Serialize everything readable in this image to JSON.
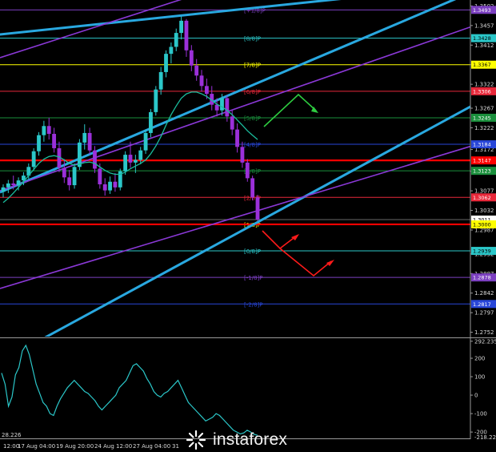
{
  "chart_data": [
    {
      "type": "candlestick",
      "instrument": "GBP/USD",
      "y_ticks": [
        "1.3502",
        "1.3457",
        "1.3412",
        "1.3367",
        "1.3322",
        "1.3267",
        "1.3222",
        "1.3172",
        "1.3122",
        "1.3077",
        "1.3032",
        "1.2987",
        "1.2932",
        "1.2887",
        "1.2842",
        "1.2797",
        "1.2752"
      ],
      "ylim": [
        1.2742,
        1.3512
      ],
      "price_tags": [
        {
          "value": "1.3493",
          "price": 1.3493,
          "color": "#7b3fc0"
        },
        {
          "value": "1.3428",
          "price": 1.3428,
          "color": "#2bc7c9"
        },
        {
          "value": "1.3367",
          "price": 1.3367,
          "color": "#ffff00"
        },
        {
          "value": "1.3306",
          "price": 1.3306,
          "color": "#e8283a"
        },
        {
          "value": "1.3245",
          "price": 1.3245,
          "color": "#1a8f3c"
        },
        {
          "value": "1.3184",
          "price": 1.3184,
          "color": "#2846d8"
        },
        {
          "value": "1.3147",
          "price": 1.3147,
          "color": "#ff0000"
        },
        {
          "value": "1.3123",
          "price": 1.3123,
          "color": "#1a8f3c"
        },
        {
          "value": "1.3062",
          "price": 1.3062,
          "color": "#e8283a"
        },
        {
          "value": "1.3011",
          "price": 1.3011,
          "color": "#ffffff"
        },
        {
          "value": "1.3000",
          "price": 1.3,
          "color": "#ffff00"
        },
        {
          "value": "1.2939",
          "price": 1.2939,
          "color": "#2bc7c9"
        },
        {
          "value": "1.2878",
          "price": 1.2878,
          "color": "#7b3fc0"
        },
        {
          "value": "1.2817",
          "price": 1.2817,
          "color": "#2846d8"
        }
      ],
      "murrey_levels": [
        {
          "label": "[+1/8]P",
          "price": 1.3493,
          "color": "#7b3fc0"
        },
        {
          "label": "[8/8]P",
          "price": 1.3428,
          "color": "#2bc7c9"
        },
        {
          "label": "[7/8]P",
          "price": 1.3367,
          "color": "#ffff00"
        },
        {
          "label": "[6/8]P",
          "price": 1.3306,
          "color": "#e8283a"
        },
        {
          "label": "[5/8]P",
          "price": 1.3245,
          "color": "#1a8f3c"
        },
        {
          "label": "[4/8]P",
          "price": 1.3184,
          "color": "#2846d8"
        },
        {
          "label": "[3/8]P",
          "price": 1.3123,
          "color": "#1a8f3c"
        },
        {
          "label": "[2/8]P",
          "price": 1.3062,
          "color": "#e8283a"
        },
        {
          "label": "[1/8]P",
          "price": 1.3,
          "color": "#ffff00"
        },
        {
          "label": "[0/8]P",
          "price": 1.2939,
          "color": "#2bc7c9"
        },
        {
          "label": "[-1/8]P",
          "price": 1.2878,
          "color": "#7b3fc0"
        },
        {
          "label": "[-2/8]P",
          "price": 1.2817,
          "color": "#2846d8"
        }
      ],
      "support_resistance": [
        1.3147,
        1.3
      ],
      "close_price": 1.3011,
      "candles_ohlc": [
        [
          1.3075,
          1.3092,
          1.3062,
          1.3085
        ],
        [
          1.3085,
          1.3102,
          1.3072,
          1.3094
        ],
        [
          1.3094,
          1.3112,
          1.308,
          1.309
        ],
        [
          1.309,
          1.3108,
          1.3078,
          1.3101
        ],
        [
          1.3101,
          1.312,
          1.309,
          1.3112
        ],
        [
          1.3112,
          1.314,
          1.3104,
          1.3132
        ],
        [
          1.3132,
          1.3175,
          1.3124,
          1.3168
        ],
        [
          1.3168,
          1.3212,
          1.3158,
          1.3205
        ],
        [
          1.3205,
          1.3238,
          1.319,
          1.3226
        ],
        [
          1.3226,
          1.3245,
          1.3195,
          1.3208
        ],
        [
          1.3208,
          1.3222,
          1.3165,
          1.3175
        ],
        [
          1.3175,
          1.319,
          1.312,
          1.313
        ],
        [
          1.313,
          1.315,
          1.3095,
          1.3108
        ],
        [
          1.3108,
          1.3125,
          1.3078,
          1.309
        ],
        [
          1.309,
          1.314,
          1.3082,
          1.3132
        ],
        [
          1.3132,
          1.3196,
          1.3125,
          1.3188
        ],
        [
          1.3188,
          1.323,
          1.3172,
          1.321
        ],
        [
          1.321,
          1.3222,
          1.316,
          1.317
        ],
        [
          1.317,
          1.318,
          1.3118,
          1.3128
        ],
        [
          1.3128,
          1.314,
          1.3082,
          1.3092
        ],
        [
          1.3092,
          1.3106,
          1.3066,
          1.3078
        ],
        [
          1.3078,
          1.311,
          1.307,
          1.3098
        ],
        [
          1.3098,
          1.3118,
          1.3075,
          1.3085
        ],
        [
          1.3085,
          1.3128,
          1.3078,
          1.3122
        ],
        [
          1.3122,
          1.3168,
          1.3114,
          1.316
        ],
        [
          1.316,
          1.319,
          1.313,
          1.3142
        ],
        [
          1.3142,
          1.316,
          1.3118,
          1.3148
        ],
        [
          1.3148,
          1.3178,
          1.3138,
          1.317
        ],
        [
          1.317,
          1.3218,
          1.3162,
          1.321
        ],
        [
          1.321,
          1.3265,
          1.32,
          1.3258
        ],
        [
          1.3258,
          1.3318,
          1.325,
          1.331
        ],
        [
          1.331,
          1.3362,
          1.3298,
          1.335
        ],
        [
          1.335,
          1.34,
          1.3338,
          1.3392
        ],
        [
          1.3392,
          1.3418,
          1.337,
          1.3408
        ],
        [
          1.3408,
          1.345,
          1.3398,
          1.344
        ],
        [
          1.344,
          1.3478,
          1.3425,
          1.3468
        ],
        [
          1.3468,
          1.3472,
          1.3385,
          1.34
        ],
        [
          1.34,
          1.3412,
          1.3352,
          1.3365
        ],
        [
          1.3365,
          1.338,
          1.333,
          1.3342
        ],
        [
          1.3342,
          1.3355,
          1.3305,
          1.3318
        ],
        [
          1.3318,
          1.3335,
          1.3288,
          1.33
        ],
        [
          1.33,
          1.3318,
          1.3262,
          1.3275
        ],
        [
          1.3275,
          1.329,
          1.3248,
          1.3262
        ],
        [
          1.3262,
          1.33,
          1.325,
          1.329
        ],
        [
          1.329,
          1.3296,
          1.3236,
          1.3248
        ],
        [
          1.3248,
          1.3262,
          1.3205,
          1.3218
        ],
        [
          1.3218,
          1.3232,
          1.3165,
          1.3178
        ],
        [
          1.3178,
          1.319,
          1.313,
          1.3142
        ],
        [
          1.3142,
          1.315,
          1.3098,
          1.3106
        ],
        [
          1.3106,
          1.3112,
          1.3055,
          1.3062
        ],
        [
          1.3062,
          1.3068,
          1.3008,
          1.3011
        ]
      ],
      "moving_average": [
        1.305,
        1.306,
        1.3072,
        1.3085,
        1.3098,
        1.3112,
        1.3126,
        1.314,
        1.315,
        1.3156,
        1.3158,
        1.3155,
        1.3148,
        1.314,
        1.3136,
        1.3138,
        1.3142,
        1.3143,
        1.314,
        1.3132,
        1.3124,
        1.3118,
        1.3115,
        1.3115,
        1.312,
        1.3128,
        1.3134,
        1.314,
        1.3148,
        1.3162,
        1.318,
        1.3202,
        1.3228,
        1.3252,
        1.3272,
        1.329,
        1.33,
        1.3304,
        1.3304,
        1.33,
        1.3294,
        1.3285,
        1.3276,
        1.327,
        1.3262,
        1.3252,
        1.324,
        1.3228,
        1.3215,
        1.3205,
        1.3195
      ]
    },
    {
      "type": "line",
      "indicator": "CCI",
      "y_ticks": [
        "292.2359",
        "200",
        "100",
        "0",
        "-100",
        "-200"
      ],
      "top_value": 292.2359,
      "bottom_value": -218.226,
      "bottom_label_left": "28.226",
      "bottom_label_right": "-218.226",
      "ylim": [
        -230,
        300
      ],
      "values": [
        120,
        60,
        -60,
        -10,
        110,
        150,
        240,
        270,
        220,
        140,
        60,
        10,
        -40,
        -60,
        -100,
        -110,
        -60,
        -20,
        10,
        40,
        60,
        80,
        60,
        40,
        20,
        10,
        -10,
        -30,
        -60,
        -80,
        -60,
        -40,
        -20,
        0,
        40,
        60,
        80,
        120,
        160,
        170,
        150,
        130,
        90,
        60,
        20,
        0,
        -10,
        10,
        20,
        40,
        60,
        80,
        40,
        0,
        -40,
        -60,
        -80,
        -100,
        -120,
        -140,
        -130,
        -120,
        -100,
        -110,
        -130,
        -150,
        -170,
        -190,
        -200,
        -210,
        -205,
        -190,
        -200,
        -212,
        -218
      ]
    }
  ],
  "time_axis": {
    "labels": [
      "12:00",
      "17 Aug 04:00",
      "19 Aug 20:00",
      "24 Aug 12:00",
      "27 Aug 04:00",
      "31"
    ]
  },
  "watermark": {
    "text": "instaforex"
  },
  "colors": {
    "background": "#000000",
    "bull_candle": "#2bc7c9",
    "bear_candle": "#9b30d9",
    "channel_blue": "#29a8e0",
    "channel_purple": "#8a38d6",
    "ma_line": "#1abc9c",
    "arrow_green": "#2ecc40",
    "arrow_red": "#ff1a1a",
    "cci_line": "#2bc7c9",
    "axis_text": "#d8d8d8"
  }
}
